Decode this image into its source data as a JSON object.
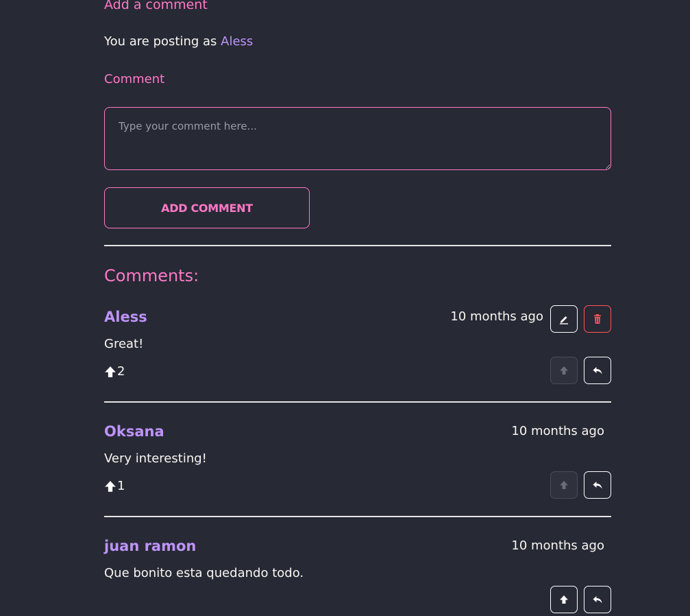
{
  "form": {
    "title": "Add a comment",
    "posting_as_prefix": "You are posting as ",
    "posting_as_user": "Aless",
    "comment_label": "Comment",
    "comment_placeholder": "Type your comment here...",
    "submit_label": "ADD COMMENT"
  },
  "comments_heading": "Comments:",
  "comments": [
    {
      "author": "Aless",
      "time": "10 months ago",
      "body": "Great!",
      "votes": "2",
      "can_edit": true,
      "upvote_disabled": true
    },
    {
      "author": "Oksana",
      "time": "10 months ago",
      "body": "Very interesting!",
      "votes": "1",
      "can_edit": false,
      "upvote_disabled": true
    },
    {
      "author": "juan ramon",
      "time": "10 months ago",
      "body": "Que bonito esta quedando todo.",
      "votes": "",
      "can_edit": false,
      "upvote_disabled": false
    }
  ],
  "colors": {
    "background": "#272935",
    "accent_pink": "#ff79c6",
    "accent_purple": "#bd93f9",
    "danger_red": "#ff5555",
    "text": "#f8f8f2"
  },
  "icons": {
    "upvote": "arrow-up-icon",
    "reply": "reply-icon",
    "edit": "pencil-icon",
    "delete": "trash-icon"
  }
}
